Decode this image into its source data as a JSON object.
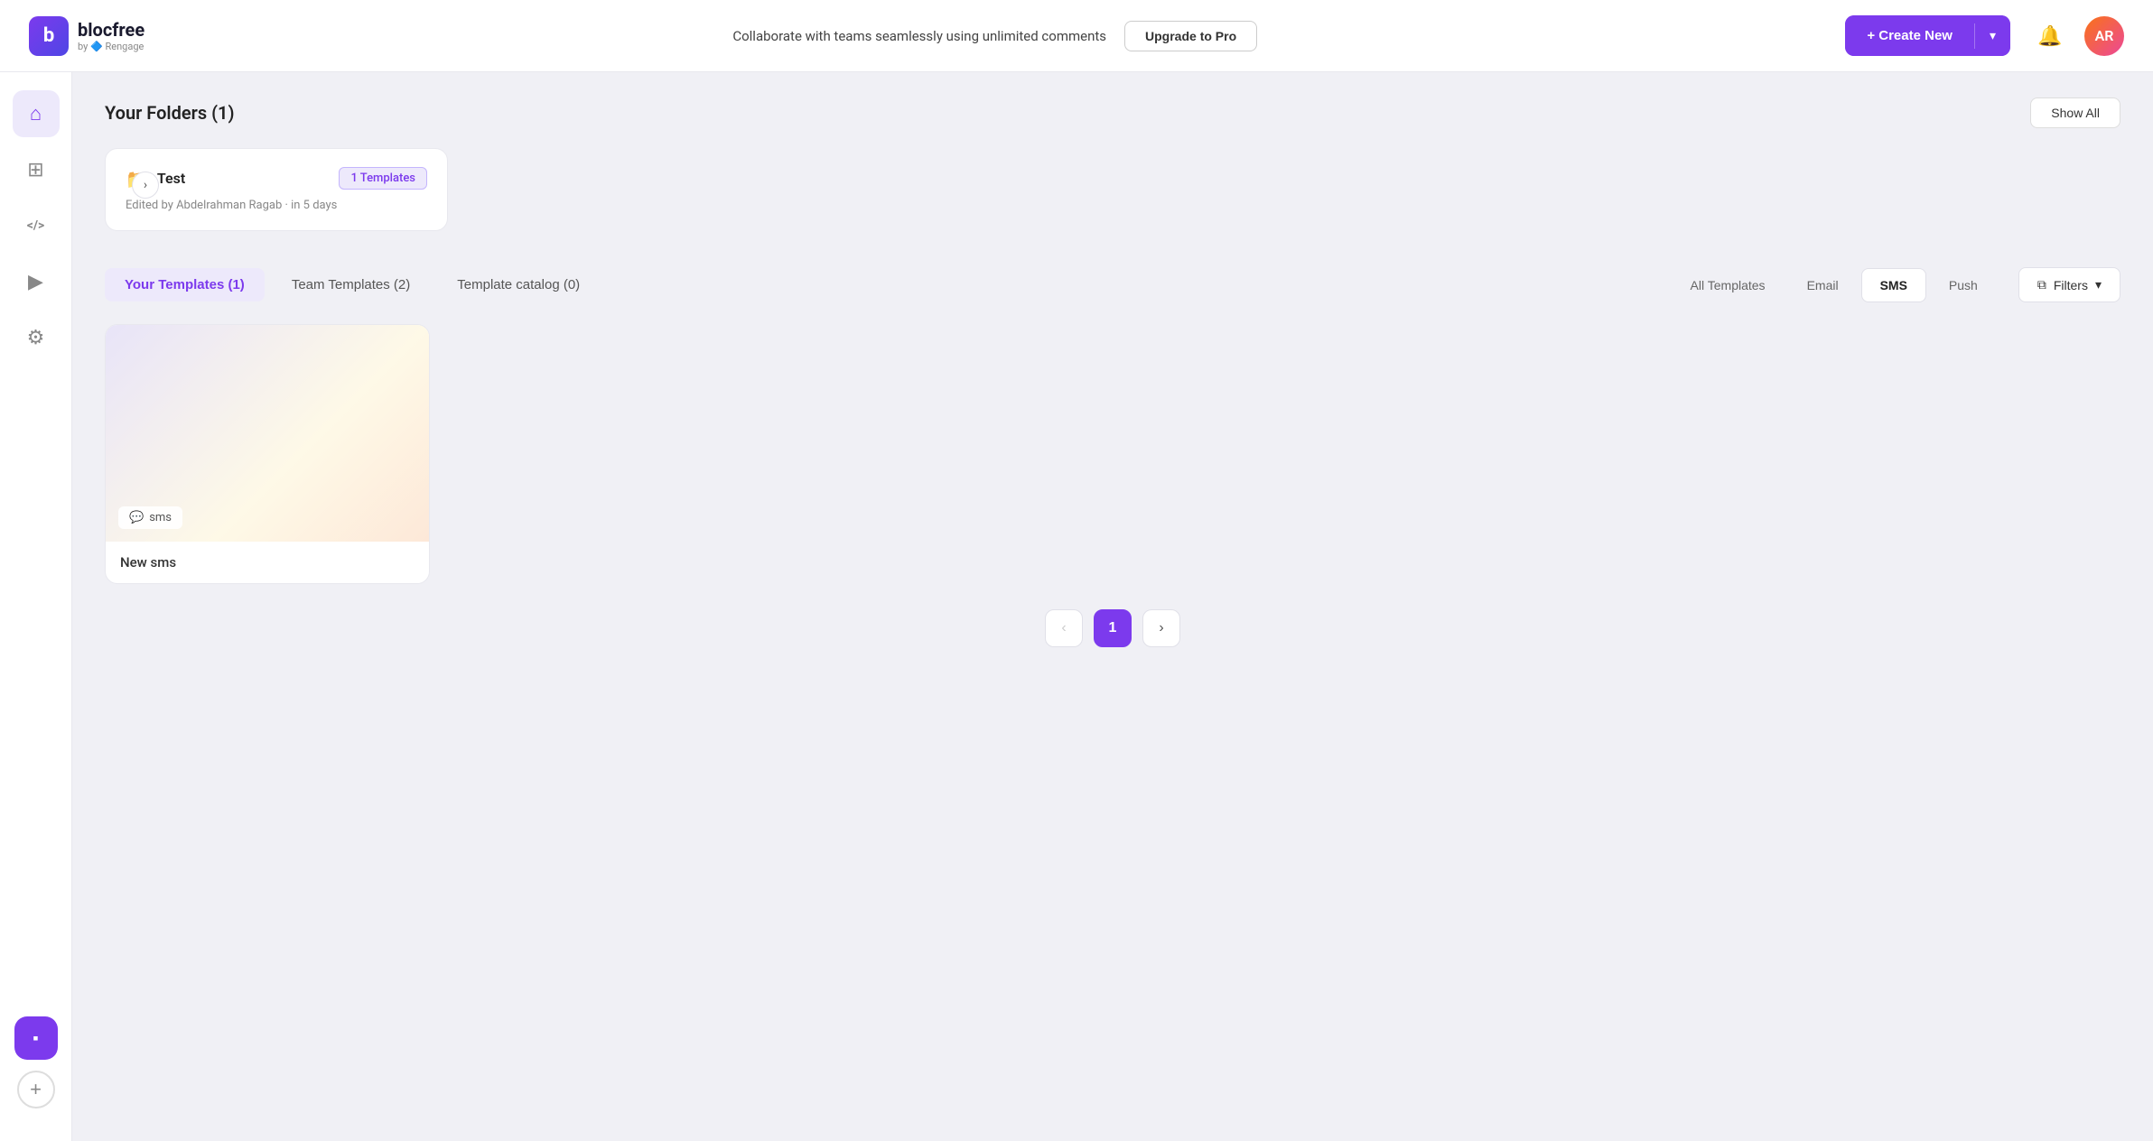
{
  "header": {
    "logo_letter": "b",
    "logo_name": "blocfree",
    "logo_sub": "by 🔷 Rengage",
    "promo_text": "Collaborate with teams seamlessly using unlimited comments",
    "upgrade_label": "Upgrade to Pro",
    "create_label": "+ Create New"
  },
  "sidebar": {
    "items": [
      {
        "id": "home",
        "icon": "⌂",
        "active": true
      },
      {
        "id": "templates",
        "icon": "⊞",
        "active": false
      },
      {
        "id": "code",
        "icon": "</>",
        "active": false
      },
      {
        "id": "play",
        "icon": "▶",
        "active": false
      },
      {
        "id": "settings",
        "icon": "⚙",
        "active": false
      }
    ]
  },
  "folders": {
    "title": "Your Folders (1)",
    "show_all_label": "Show All",
    "items": [
      {
        "name": "Test",
        "badge": "1 Templates",
        "meta": "Edited by Abdelrahman Ragab · in 5 days"
      }
    ]
  },
  "templates": {
    "tabs": [
      {
        "id": "your",
        "label": "Your Templates (1)",
        "active": true
      },
      {
        "id": "team",
        "label": "Team Templates (2)",
        "active": false
      },
      {
        "id": "catalog",
        "label": "Template catalog (0)",
        "active": false
      }
    ],
    "filters": [
      {
        "id": "all",
        "label": "All Templates",
        "active": false
      },
      {
        "id": "email",
        "label": "Email",
        "active": false
      },
      {
        "id": "sms",
        "label": "SMS",
        "active": true
      },
      {
        "id": "push",
        "label": "Push",
        "active": false
      }
    ],
    "filters_label": "Filters",
    "items": [
      {
        "name": "New sms",
        "type": "sms",
        "type_icon": "💬"
      }
    ]
  },
  "pagination": {
    "prev_label": "‹",
    "next_label": "›",
    "current": 1,
    "pages": [
      1
    ]
  }
}
